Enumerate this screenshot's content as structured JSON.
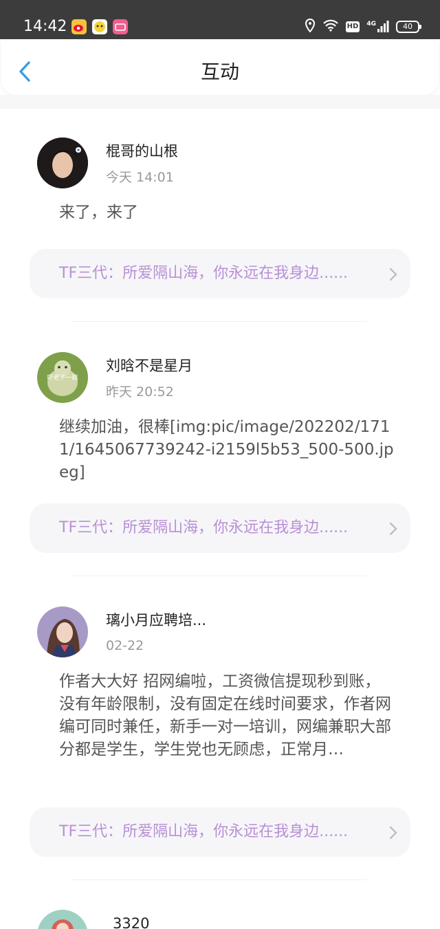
{
  "status_bar": {
    "time": "14:42",
    "battery": "40",
    "network": "4G",
    "hd": "HD"
  },
  "header": {
    "title": "互动",
    "back_icon": "chevron-left-icon"
  },
  "colors": {
    "accent": "#3a9be6",
    "reference_text": "#b88fd6",
    "status_bar": "#3c3c3c"
  },
  "items": [
    {
      "username": "棍哥的山根",
      "time": "今天 14:01",
      "content": "来了，来了",
      "reference": "TF三代：所爱隔山海，你永远在我身边......"
    },
    {
      "username": "刘晗不是星月",
      "time": "昨天 20:52",
      "avatar_text": "吓老子一跳",
      "content": "继续加油，很棒[img:pic/image/202202/1711/1645067739242-i2159l5b53_500-500.jpeg]",
      "reference": "TF三代：所爱隔山海，你永远在我身边......"
    },
    {
      "username": "璃小月应聘培...",
      "time": "02-22",
      "content": "作者大大好 招网编啦，工资微信提现秒到账，没有年龄限制，没有固定在线时间要求，作者网编可同时兼任，新手一对一培训，网编兼职大部分都是学生，学生党也无顾虑，正常月…",
      "reference": "TF三代：所爱隔山海，你永远在我身边......"
    },
    {
      "username": "3320"
    }
  ]
}
